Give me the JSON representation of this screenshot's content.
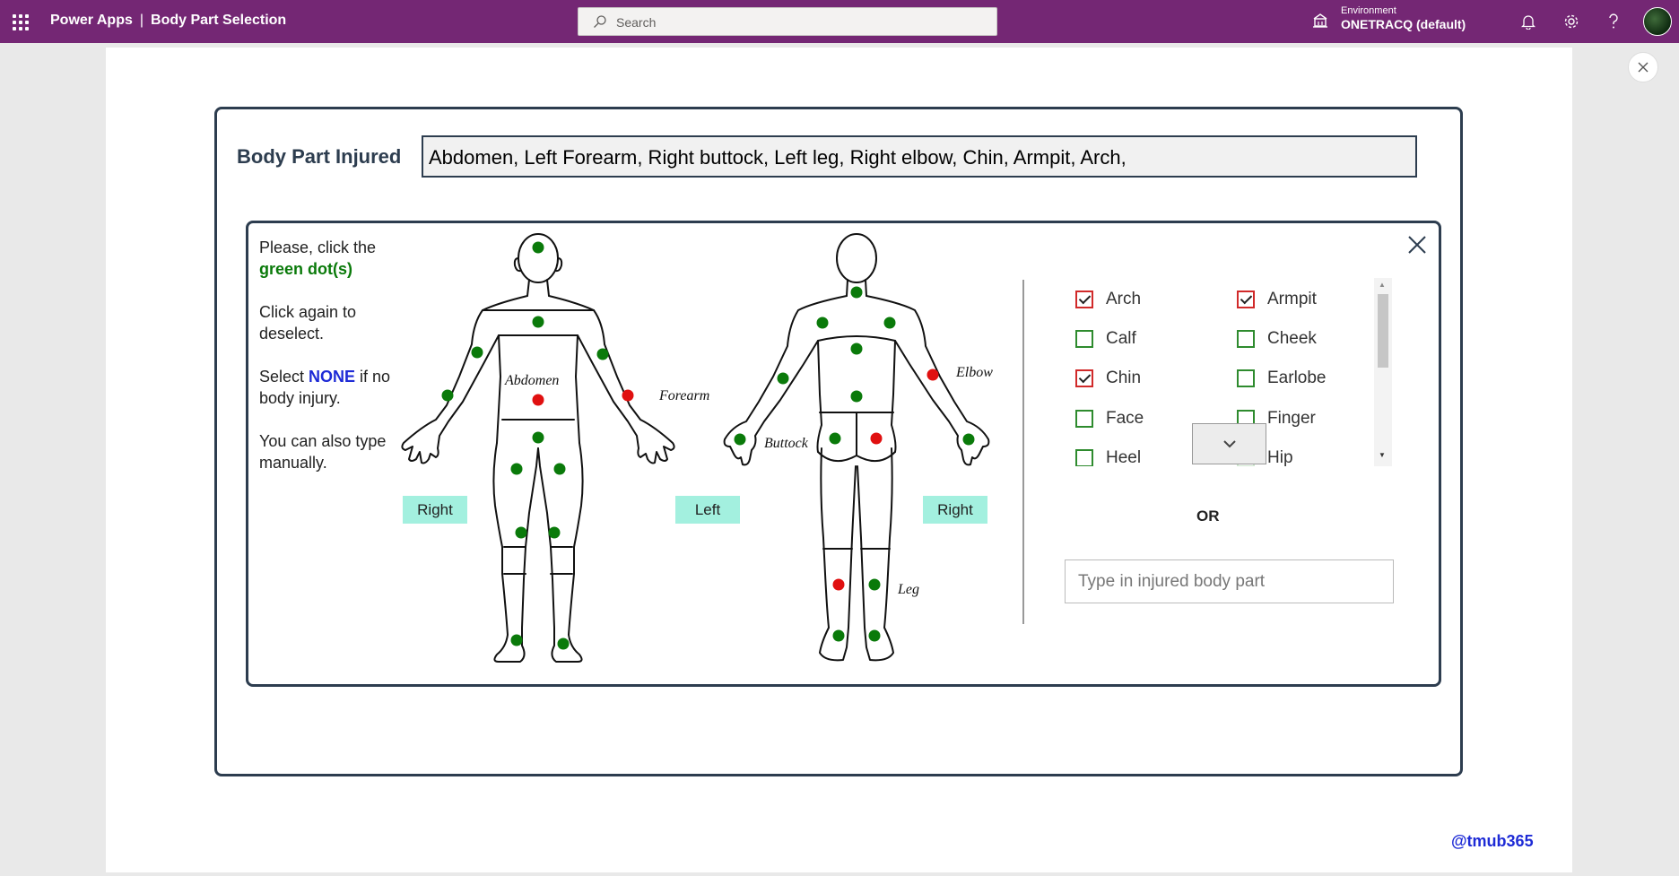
{
  "header": {
    "app_name": "Power Apps",
    "separator": "|",
    "page_title": "Body Part Selection",
    "search_placeholder": "Search",
    "environment_label": "Environment",
    "environment_name": "ONETRACQ (default)"
  },
  "form": {
    "label": "Body Part Injured",
    "value": "Abdomen, Left Forearm, Right buttock, Left leg, Right elbow, Chin, Armpit, Arch,"
  },
  "instructions": {
    "line1": "Please, click the",
    "line1_green": "green dot(s)",
    "line2": "Click again to deselect.",
    "line3_pre": "Select ",
    "line3_none": "NONE",
    "line3_post": " if no body injury.",
    "line4": "You can also type manually."
  },
  "figure": {
    "labels": {
      "abdomen": "Abdomen",
      "forearm": "Forearm",
      "elbow": "Elbow",
      "buttock": "Buttock",
      "leg": "Leg"
    },
    "buttons": {
      "front_right": "Right",
      "front_left": "Left",
      "back_right": "Right"
    },
    "colors": {
      "unselected": "#0a7a0a",
      "selected": "#e01010"
    }
  },
  "checklist": {
    "items": [
      {
        "label": "Arch",
        "checked": true
      },
      {
        "label": "Armpit",
        "checked": true
      },
      {
        "label": "Calf",
        "checked": false
      },
      {
        "label": "Cheek",
        "checked": false
      },
      {
        "label": "Chin",
        "checked": true
      },
      {
        "label": "Earlobe",
        "checked": false
      },
      {
        "label": "Face",
        "checked": false
      },
      {
        "label": "Finger",
        "checked": false
      },
      {
        "label": "Heel",
        "checked": false
      },
      {
        "label": "Hip",
        "checked": false
      }
    ]
  },
  "or_label": "OR",
  "manual_input": {
    "placeholder": "Type in injured body part",
    "value": ""
  },
  "watermark": "@tmub365",
  "colors": {
    "brand": "#742774",
    "accent_teal": "#a3f0df",
    "border_dark": "#2d3d4f"
  }
}
